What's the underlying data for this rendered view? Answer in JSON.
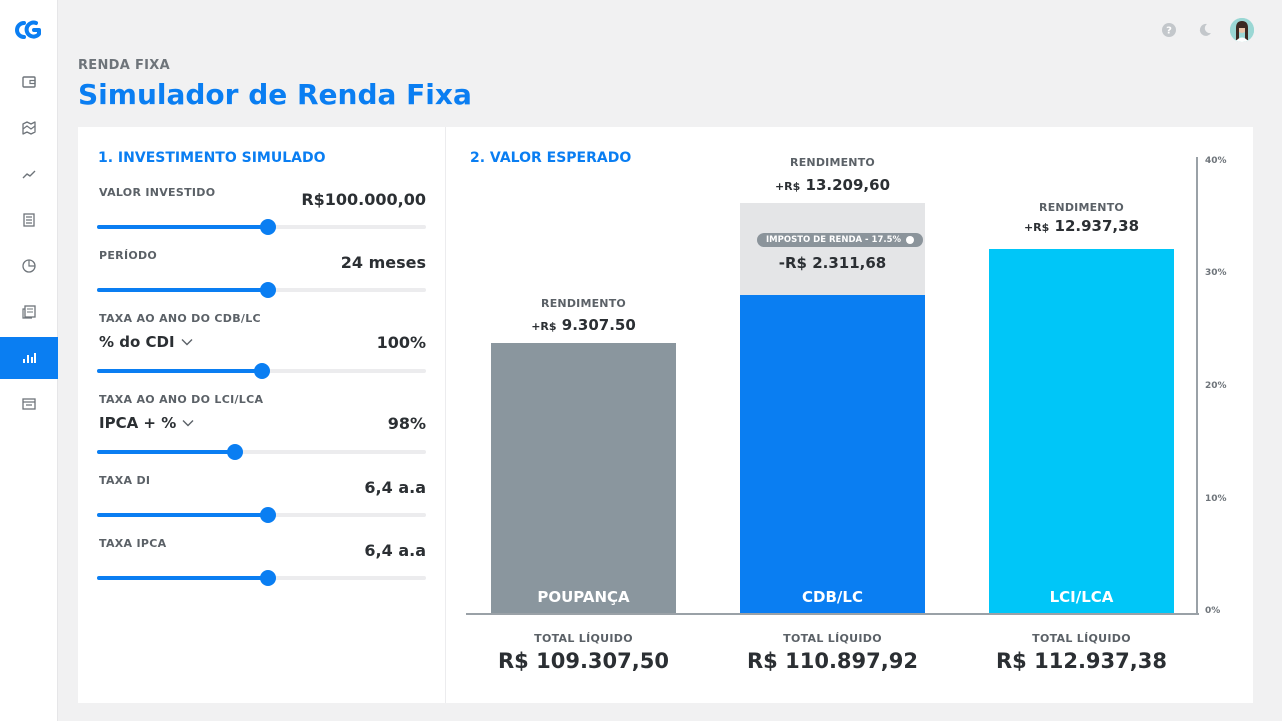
{
  "colors": {
    "accent": "#0a7ef2",
    "poupanca": "#8a969e",
    "cdb": "#0a7ef2",
    "lci": "#00c6f8",
    "tax_box": "#e4e5e7"
  },
  "sidebar": {
    "items": [
      {
        "icon": "wallet-icon",
        "active": false
      },
      {
        "icon": "map-icon",
        "active": false
      },
      {
        "icon": "trend-line-icon",
        "active": false
      },
      {
        "icon": "list-icon",
        "active": false
      },
      {
        "icon": "pie-chart-icon",
        "active": false
      },
      {
        "icon": "news-icon",
        "active": false
      },
      {
        "icon": "bar-chart-icon",
        "active": true
      },
      {
        "icon": "calendar-icon",
        "active": false
      }
    ]
  },
  "header": {
    "breadcrumb": "RENDA FIXA",
    "title": "Simulador de Renda Fixa"
  },
  "simulation": {
    "title": "1. INVESTIMENTO SIMULADO",
    "fields": {
      "valor": {
        "label": "VALOR INVESTIDO",
        "value": "R$100.000,00",
        "level": 0.52
      },
      "periodo": {
        "label": "PERÍODO",
        "value": "24 meses",
        "level": 0.52
      },
      "cdb": {
        "label": "TAXA AO ANO DO CDB/LC",
        "select": "% do CDI",
        "value": "100%",
        "level": 0.5
      },
      "lci": {
        "label": "TAXA AO ANO DO LCI/LCA",
        "select": "IPCA + %",
        "value": "98%",
        "level": 0.42
      },
      "di": {
        "label": "TAXA DI",
        "value": "6,4 a.a",
        "level": 0.52
      },
      "ipca": {
        "label": "TAXA IPCA",
        "value": "6,4 a.a",
        "level": 0.52
      }
    }
  },
  "expected": {
    "title": "2. VALOR ESPERADO",
    "rendimento_label": "RENDIMENTO",
    "total_label": "TOTAL LÍQUIDO",
    "currency_prefix": "+R$",
    "tax_label": "IMPOSTO DE RENDA - 17.5%",
    "tax_value": "-R$ 2.311,68",
    "y_ticks": [
      "40%",
      "30%",
      "20%",
      "10%",
      "0%"
    ],
    "bars": {
      "poupanca": {
        "name": "POUPANÇA",
        "rendimento": "9.307.50",
        "total": "R$ 109.307,50"
      },
      "cdb": {
        "name": "CDB/LC",
        "rendimento": "13.209,60",
        "total": "R$ 110.897,92"
      },
      "lci": {
        "name": "LCI/LCA",
        "rendimento": "12.937,38",
        "total": "R$ 112.937,38"
      }
    }
  }
}
